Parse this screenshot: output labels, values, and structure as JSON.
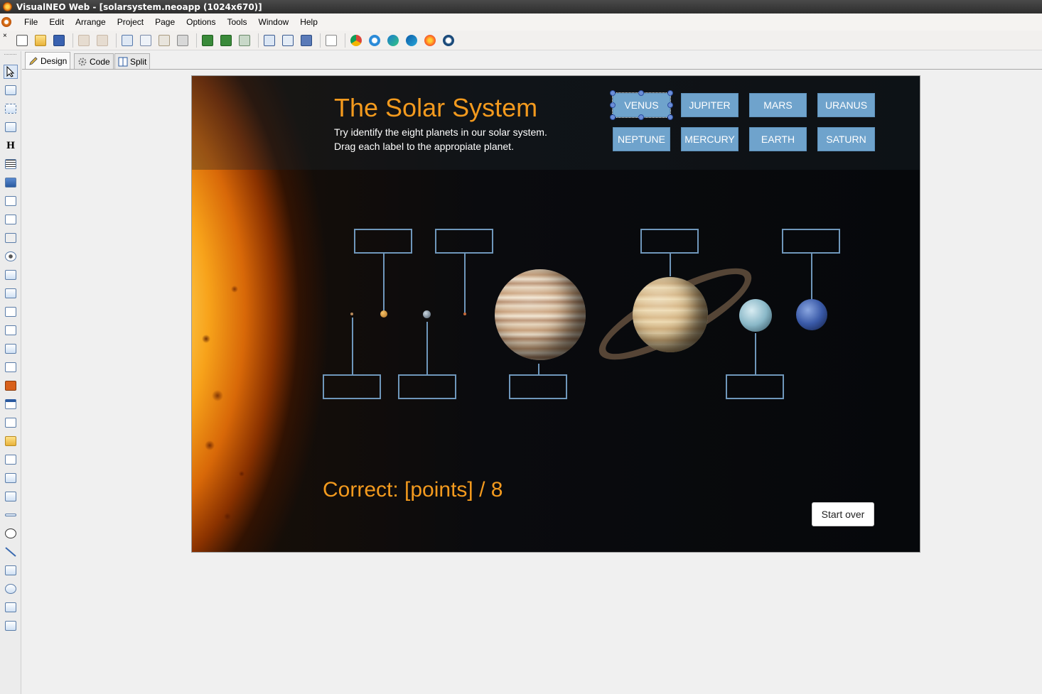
{
  "window": {
    "title": "VisualNEO Web - [solarsystem.neoapp (1024x670)]"
  },
  "menu": {
    "items": [
      "File",
      "Edit",
      "Arrange",
      "Project",
      "Page",
      "Options",
      "Tools",
      "Window",
      "Help"
    ]
  },
  "toolbar": {
    "close_glyph": "×"
  },
  "tabs": {
    "design": "Design",
    "code": "Code",
    "split": "Split"
  },
  "app": {
    "title": "The Solar System",
    "subtitle_line1": "Try identify the eight planets in our solar system.",
    "subtitle_line2": "Drag each label to the appropiate planet.",
    "labels": [
      "VENUS",
      "JUPITER",
      "MARS",
      "URANUS",
      "NEPTUNE",
      "MERCURY",
      "EARTH",
      "SATURN"
    ],
    "score_text": "Correct: [points] / 8",
    "start_over": "Start over"
  },
  "colors": {
    "accent_orange": "#f39a1e",
    "label_blue": "#6fa3cc",
    "box_outline": "#6f97bb"
  }
}
